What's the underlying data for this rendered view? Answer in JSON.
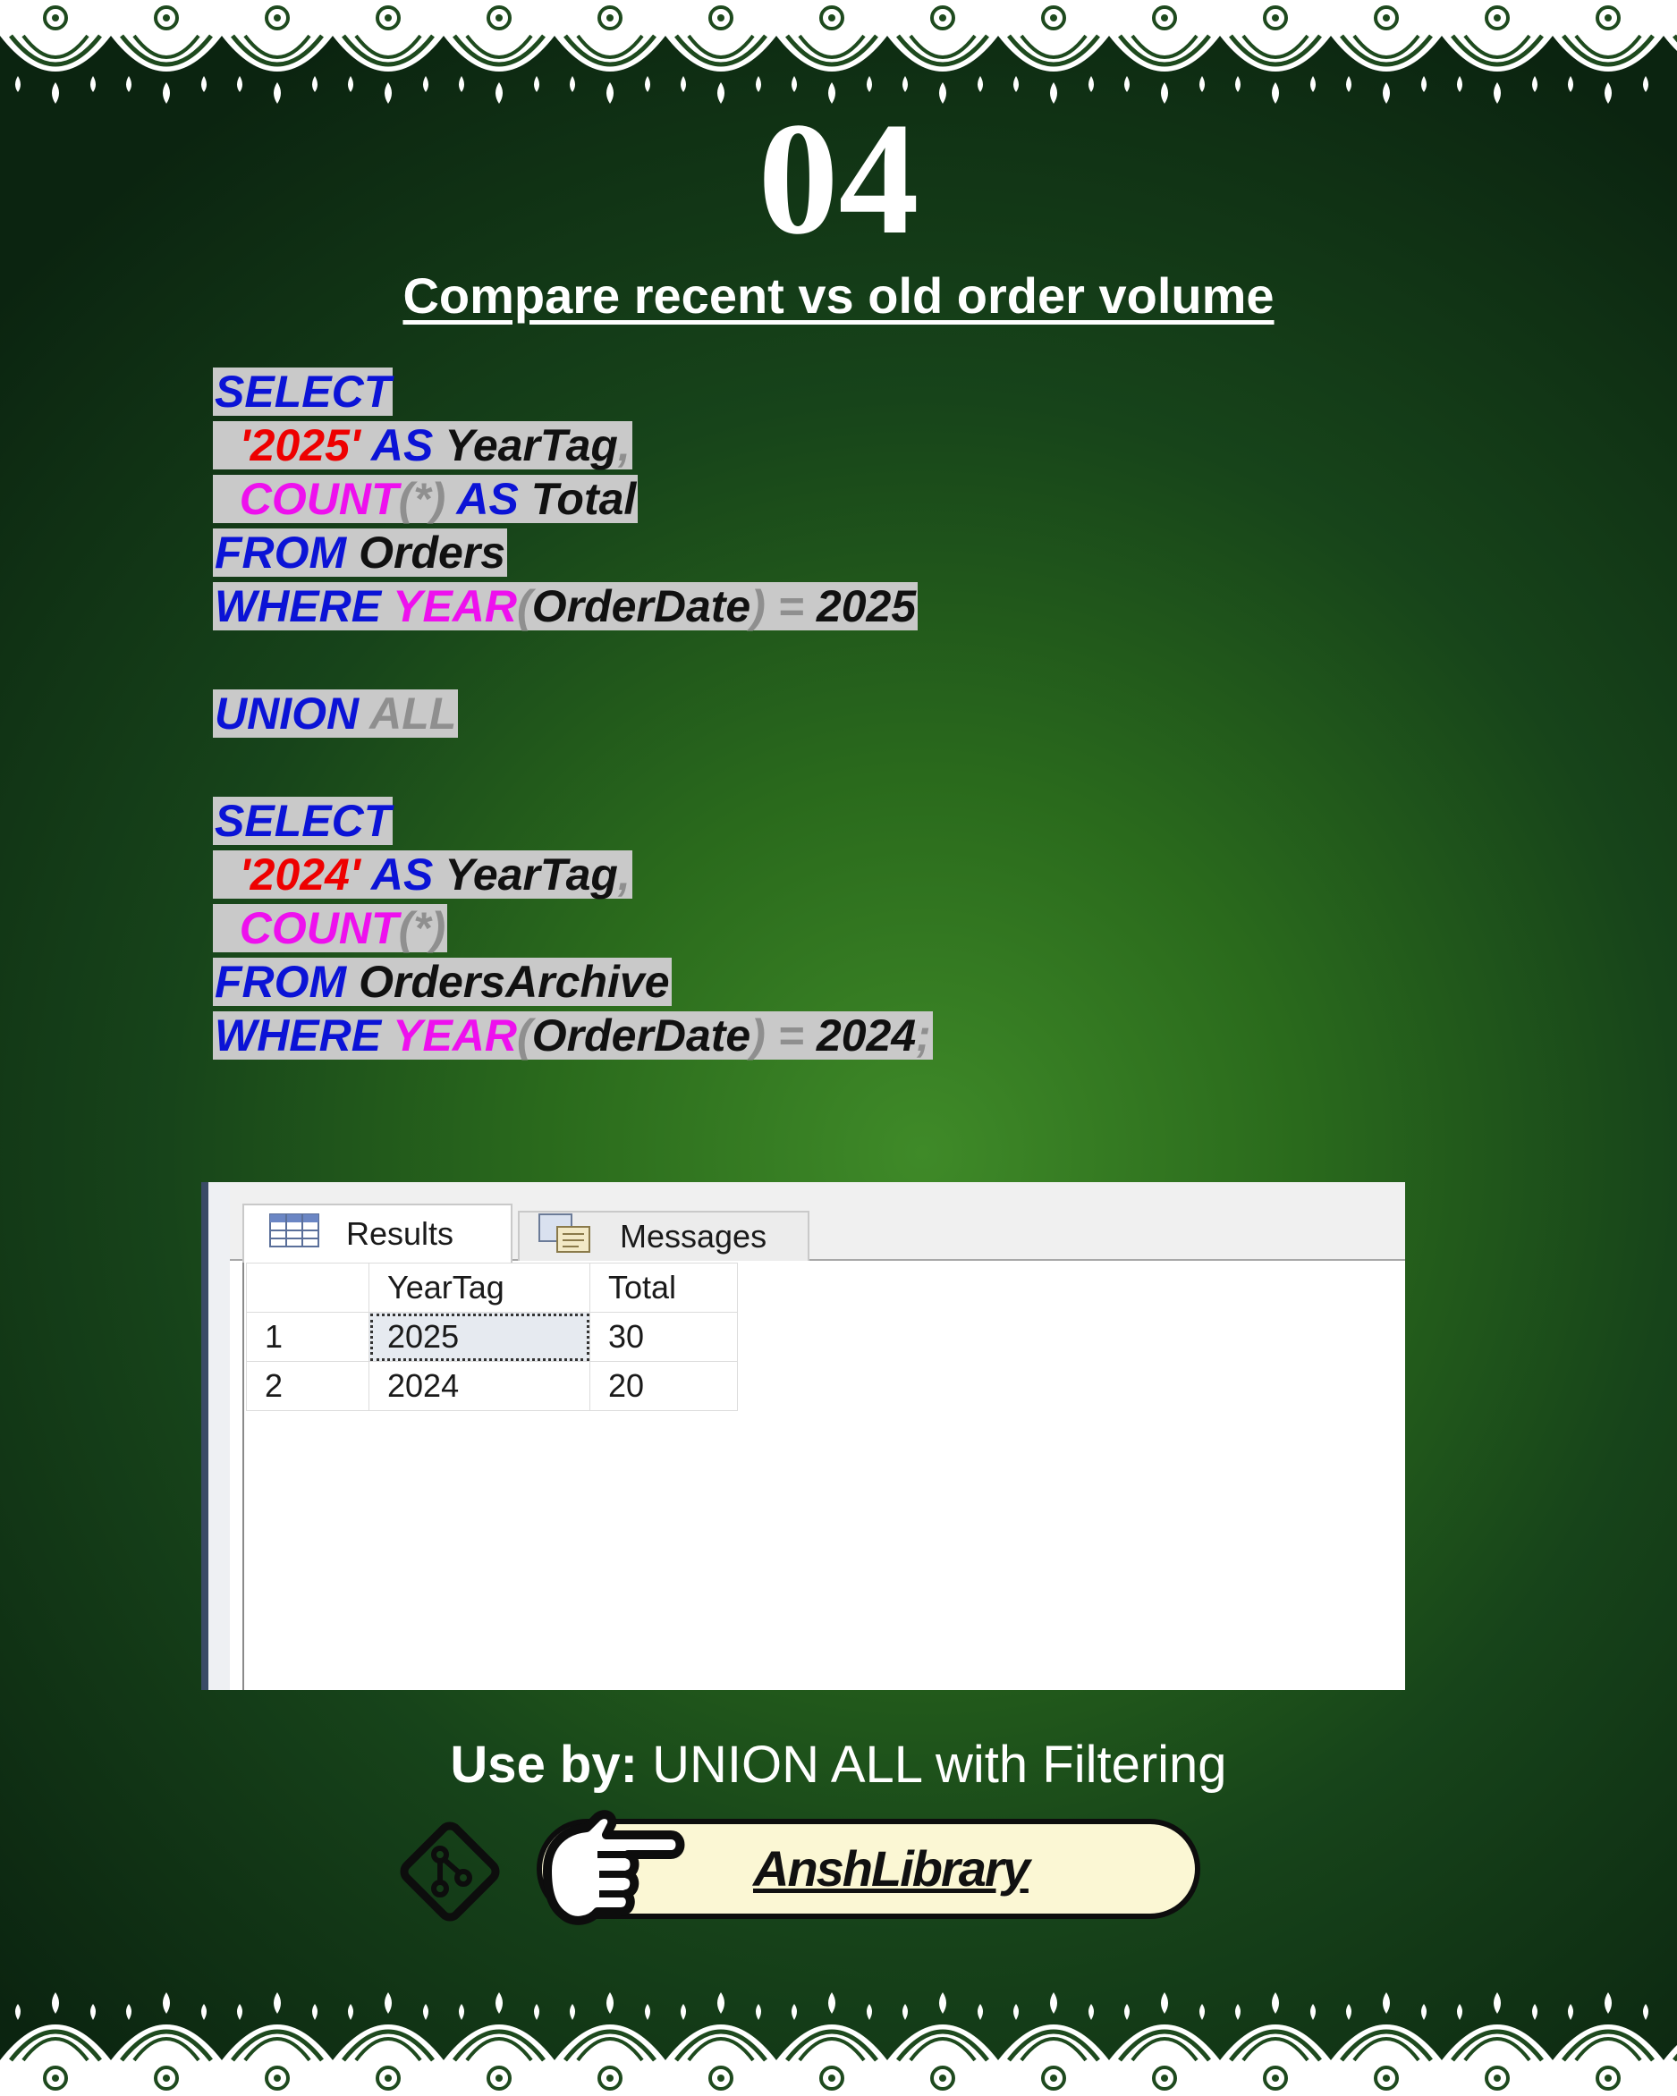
{
  "slide": {
    "number": "04",
    "title": "Compare recent vs old order volume"
  },
  "code": [
    [
      {
        "t": "SELECT",
        "c": "kw"
      }
    ],
    [
      {
        "t": "  "
      },
      {
        "t": "'2025'",
        "c": "str"
      },
      {
        "t": " "
      },
      {
        "t": "AS",
        "c": "kw"
      },
      {
        "t": " "
      },
      {
        "t": "YearTag",
        "c": "id"
      },
      {
        "t": ",",
        "c": "op"
      }
    ],
    [
      {
        "t": "  "
      },
      {
        "t": "COUNT",
        "c": "fn"
      },
      {
        "t": "(*)",
        "c": "op"
      },
      {
        "t": " "
      },
      {
        "t": "AS",
        "c": "kw"
      },
      {
        "t": " "
      },
      {
        "t": "Total",
        "c": "id"
      }
    ],
    [
      {
        "t": "FROM",
        "c": "kw"
      },
      {
        "t": " "
      },
      {
        "t": "Orders",
        "c": "id"
      }
    ],
    [
      {
        "t": "WHERE",
        "c": "kw"
      },
      {
        "t": " "
      },
      {
        "t": "YEAR",
        "c": "fn"
      },
      {
        "t": "(",
        "c": "op"
      },
      {
        "t": "OrderDate",
        "c": "id"
      },
      {
        "t": ")",
        "c": "op"
      },
      {
        "t": " "
      },
      {
        "t": "=",
        "c": "op"
      },
      {
        "t": " "
      },
      {
        "t": "2025",
        "c": "num"
      }
    ],
    [],
    [
      {
        "t": "UNION",
        "c": "kw"
      },
      {
        "t": " "
      },
      {
        "t": "ALL",
        "c": "op"
      }
    ],
    [],
    [
      {
        "t": "SELECT",
        "c": "kw"
      }
    ],
    [
      {
        "t": "  "
      },
      {
        "t": "'2024'",
        "c": "str"
      },
      {
        "t": " "
      },
      {
        "t": "AS",
        "c": "kw"
      },
      {
        "t": " "
      },
      {
        "t": "YearTag",
        "c": "id"
      },
      {
        "t": ",",
        "c": "op"
      }
    ],
    [
      {
        "t": "  "
      },
      {
        "t": "COUNT",
        "c": "fn"
      },
      {
        "t": "(*)",
        "c": "op"
      }
    ],
    [
      {
        "t": "FROM",
        "c": "kw"
      },
      {
        "t": " "
      },
      {
        "t": "OrdersArchive",
        "c": "id"
      }
    ],
    [
      {
        "t": "WHERE",
        "c": "kw"
      },
      {
        "t": " "
      },
      {
        "t": "YEAR",
        "c": "fn"
      },
      {
        "t": "(",
        "c": "op"
      },
      {
        "t": "OrderDate",
        "c": "id"
      },
      {
        "t": ")",
        "c": "op"
      },
      {
        "t": " "
      },
      {
        "t": "=",
        "c": "op"
      },
      {
        "t": " "
      },
      {
        "t": "2024",
        "c": "num"
      },
      {
        "t": ";",
        "c": "op"
      }
    ]
  ],
  "results_panel": {
    "tabs": [
      {
        "label": "Results",
        "icon": "grid-table-icon",
        "active": true
      },
      {
        "label": "Messages",
        "icon": "messages-icon",
        "active": false
      }
    ],
    "columns": [
      "YearTag",
      "Total"
    ],
    "rows": [
      {
        "num": "1",
        "YearTag": "2025",
        "Total": "30"
      },
      {
        "num": "2",
        "YearTag": "2024",
        "Total": "20"
      }
    ]
  },
  "footer": {
    "use_by_label": "Use by:",
    "use_by_value": "UNION ALL with Filtering",
    "brand": "AnshLibrary",
    "icons": [
      "git-diamond-icon",
      "pointing-hand-icon"
    ]
  },
  "colors": {
    "keyword": "#0b13d6",
    "function": "#ee10ee",
    "string": "#ee0000",
    "operator": "#8f8f8f",
    "highlight": "#c9c9c9",
    "pill_bg": "#fbf7d4"
  }
}
